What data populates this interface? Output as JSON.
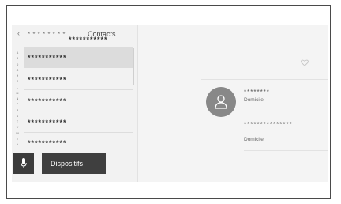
{
  "header": {
    "back_icon": "‹",
    "masked": "* * * * * * * *",
    "separator": "·",
    "title": "Contacts"
  },
  "alphabet_index": [
    "A",
    "B",
    "D",
    "G",
    "H",
    "J",
    "L",
    "M",
    "N",
    "P",
    "R",
    "S",
    "T",
    "V",
    "W",
    "Z",
    "#"
  ],
  "contacts": [
    {
      "name": "***********",
      "selected": true
    },
    {
      "name": "***********",
      "selected": false
    },
    {
      "name": "***********",
      "selected": false
    },
    {
      "name": "***********",
      "selected": false
    },
    {
      "name": "***********",
      "selected": false
    }
  ],
  "bottom_bar": {
    "mic_icon": "microphone-icon",
    "devices_label": "Dispositifs"
  },
  "detail": {
    "name": "***********",
    "favorite_icon": "heart-icon",
    "avatar_icon": "person-icon",
    "phones": [
      {
        "number": "********",
        "type": "Domicile"
      },
      {
        "number": "***************",
        "type": "Domicile"
      }
    ]
  },
  "colors": {
    "selected_row": "#dcdcdc",
    "button_bg": "#3f3f3f",
    "avatar_bg": "#888888"
  }
}
